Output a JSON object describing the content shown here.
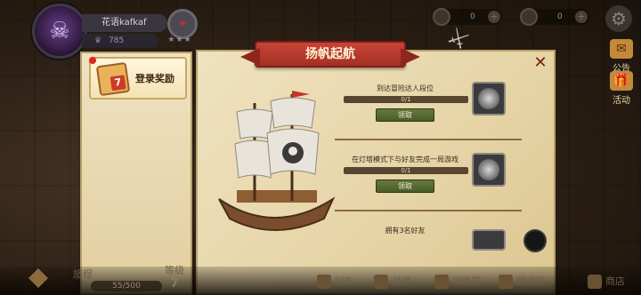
{
  "player": {
    "name": "花语kafkaf",
    "rank_value": "785"
  },
  "resources": [
    {
      "icon": "coin-icon",
      "value": "0"
    },
    {
      "icon": "gem-icon",
      "value": "0"
    }
  ],
  "side_menu": [
    {
      "label": "公告",
      "icon": "mail-icon"
    },
    {
      "label": "活动",
      "icon": "gift-icon"
    }
  ],
  "tabs": [
    {
      "label": "登录奖励",
      "badge_number": "7"
    }
  ],
  "panel": {
    "title": "扬帆起航"
  },
  "quests": [
    {
      "title": "到达冒险达人段位",
      "progress": "0/1",
      "progress_fraction": 0,
      "claim_label": "领取"
    },
    {
      "title": "在灯塔模式下与好友完成一局游戏",
      "progress": "0/1",
      "progress_fraction": 0,
      "claim_label": "领取"
    },
    {
      "title": "拥有3名好友"
    }
  ],
  "footer": {
    "voyage_label": "旅程",
    "voyage_progress": "55/500",
    "level_label": "等级",
    "level_value": "7",
    "nav": [
      {
        "label": "好友",
        "icon": "friends-icon"
      },
      {
        "label": "战绩",
        "icon": "record-icon"
      },
      {
        "label": "训练营",
        "icon": "training-icon"
      },
      {
        "label": "藏宝箱",
        "icon": "chest-icon"
      },
      {
        "label": "商店",
        "icon": "shop-icon"
      }
    ]
  },
  "colors": {
    "banner": "#b13a2d",
    "parchment": "#e6d4a6",
    "claim_button": "#5a6d33"
  }
}
